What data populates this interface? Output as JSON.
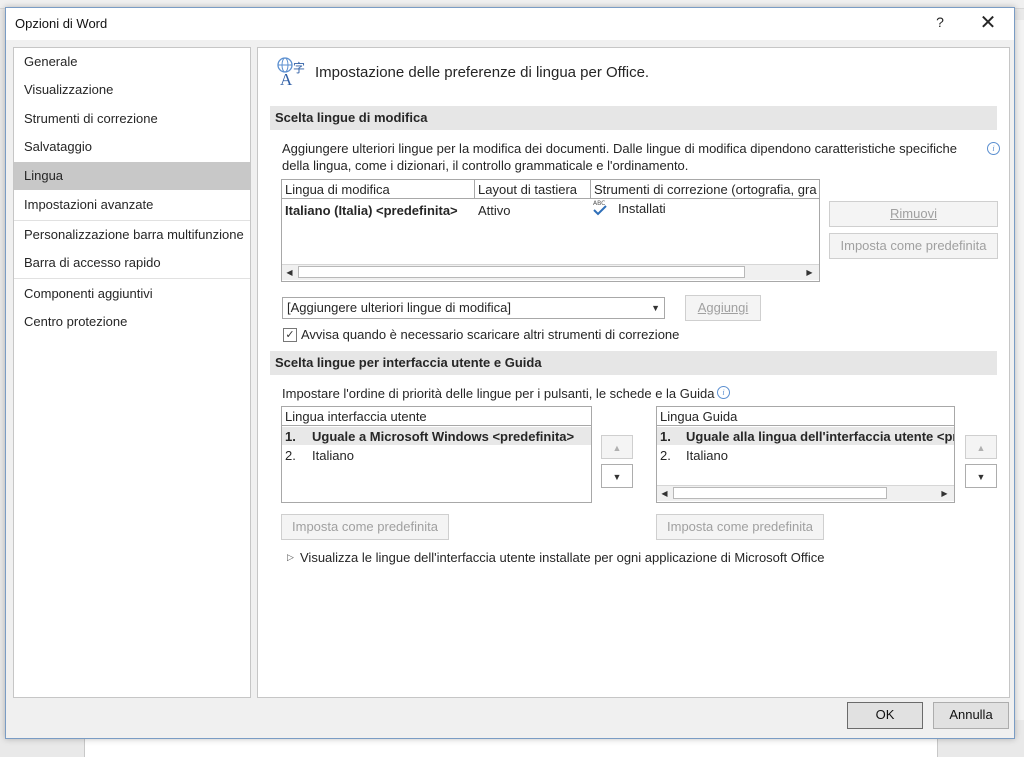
{
  "window": {
    "title": "Opzioni di Word",
    "help": "?",
    "close": "✕"
  },
  "nav": {
    "items": [
      {
        "label": "Generale"
      },
      {
        "label": "Visualizzazione"
      },
      {
        "label": "Strumenti di correzione"
      },
      {
        "label": "Salvataggio"
      },
      {
        "label": "Lingua"
      },
      {
        "label": "Impostazioni avanzate"
      },
      {
        "label": "Personalizzazione barra multifunzione"
      },
      {
        "label": "Barra di accesso rapido"
      },
      {
        "label": "Componenti aggiuntivi"
      },
      {
        "label": "Centro protezione"
      }
    ],
    "selected": "Lingua"
  },
  "header": {
    "text": "Impostazione delle preferenze di lingua per Office."
  },
  "editing": {
    "section_title": "Scelta lingue di modifica",
    "description_line1": "Aggiungere ulteriori lingue per la modifica dei documenti. Dalle lingue di modifica dipendono caratteristiche specifiche",
    "description_line2": "della lingua, come i dizionari, il controllo grammaticale e l'ordinamento.",
    "columns": [
      "Lingua di modifica",
      "Layout di tastiera",
      "Strumenti di correzione (ortografia, gra"
    ],
    "rows": [
      {
        "language": "Italiano (Italia) <predefinita>",
        "keyboard": "Attivo",
        "proofing": "Installati"
      }
    ],
    "remove_button": "Rimuovi",
    "set_default_button": "Imposta come predefinita",
    "add_combo_value": "[Aggiungere ulteriori lingue di modifica]",
    "add_button": "Aggiungi",
    "notify_checkbox_label": "Avvisa quando è necessario scaricare altri strumenti di correzione",
    "notify_checked": true
  },
  "ui": {
    "section_title": "Scelta lingue per interfaccia utente e Guida",
    "description": "Impostare l'ordine di priorità delle lingue per i pulsanti, le schede e la Guida",
    "display_list": {
      "header": "Lingua interfaccia utente",
      "items": [
        {
          "num": "1.",
          "label": "Uguale a Microsoft Windows <predefinita>"
        },
        {
          "num": "2.",
          "label": "Italiano"
        }
      ]
    },
    "help_list": {
      "header": "Lingua Guida",
      "items": [
        {
          "num": "1.",
          "label": "Uguale alla lingua dell'interfaccia utente <pr"
        },
        {
          "num": "2.",
          "label": "Italiano"
        }
      ]
    },
    "set_default_display": "Imposta come predefinita",
    "set_default_help": "Imposta come predefinita",
    "view_installed_link": "Visualizza le lingue dell'interfaccia utente installate per ogni applicazione di Microsoft Office"
  },
  "footer": {
    "ok": "OK",
    "cancel": "Annulla"
  },
  "colors": {
    "selected_nav": "#c8c8c8",
    "section_bg": "#e6e6e6",
    "accent": "#5b8fd0"
  }
}
